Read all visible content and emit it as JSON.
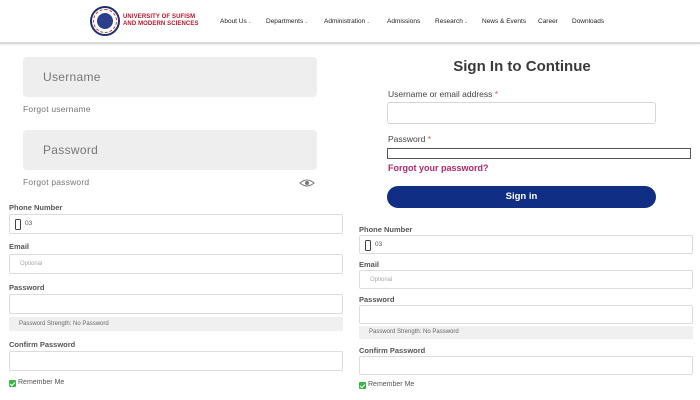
{
  "header": {
    "logo_line1": "UNIVERSITY OF SUFISM",
    "logo_line2": "AND MODERN SCIENCES",
    "nav": [
      "About Us",
      "Departments",
      "Administration",
      "Admissions",
      "Research",
      "News & Events",
      "Career",
      "Downloads"
    ],
    "nav_has_caret": [
      true,
      true,
      true,
      false,
      true,
      false,
      false,
      false
    ]
  },
  "left_login": {
    "username_placeholder": "Username",
    "forgot_username": "Forgot username",
    "password_placeholder": "Password",
    "forgot_password": "Forgot password"
  },
  "left_register": {
    "phone_label": "Phone Number",
    "phone_value": "03",
    "email_label": "Email",
    "email_placeholder": "Optional",
    "password_label": "Password",
    "strength_text": "Password Strength: No Password",
    "confirm_label": "Confirm Password",
    "remember_label": "Remember Me"
  },
  "signin": {
    "title": "Sign In to Continue",
    "username_label": "Username or email address",
    "required_mark": "*",
    "password_label": "Password",
    "forgot_link": "Forgot your password?",
    "button": "Sign in"
  },
  "right_register": {
    "phone_label": "Phone Number",
    "phone_value": "03",
    "email_label": "Email",
    "email_placeholder": "Optional",
    "password_label": "Password",
    "strength_text": "Password Strength: No Password",
    "confirm_label": "Confirm Password",
    "remember_label": "Remember Me"
  },
  "colors": {
    "brand_red": "#b5172e",
    "brand_navy": "#102e84",
    "link_pink": "#b5266d",
    "check_green": "#3bb54a"
  }
}
